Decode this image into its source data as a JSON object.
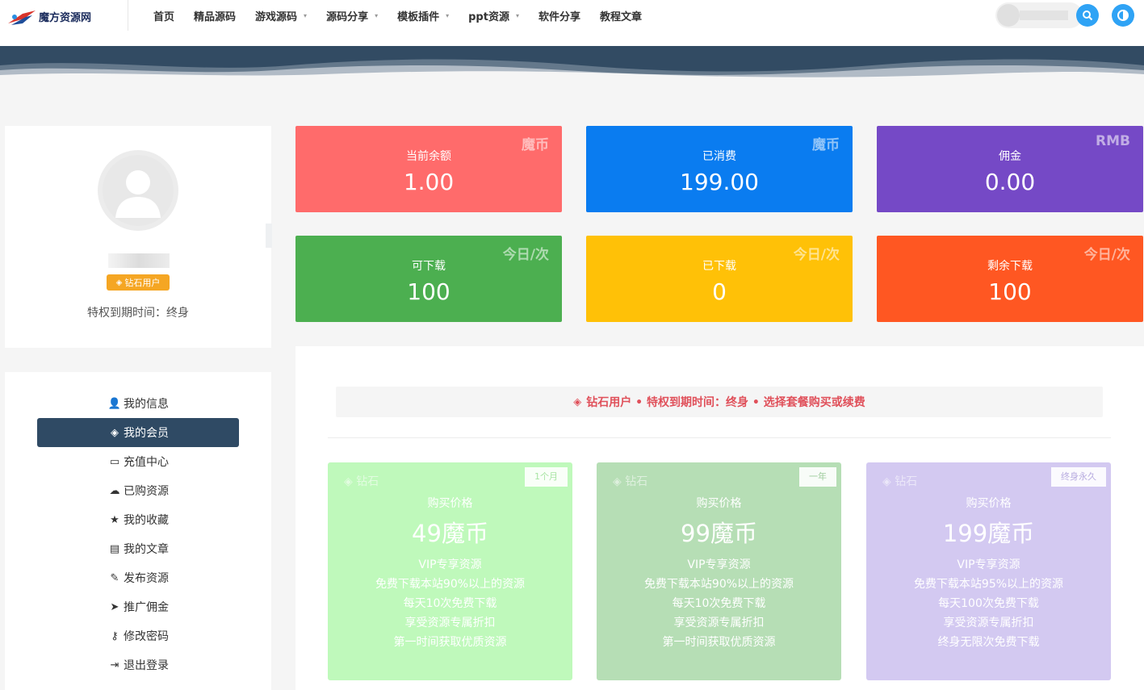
{
  "header": {
    "logo_text": "魔方资源网",
    "nav": [
      {
        "label": "首页",
        "dropdown": false
      },
      {
        "label": "精品源码",
        "dropdown": false
      },
      {
        "label": "游戏源码",
        "dropdown": true
      },
      {
        "label": "源码分享",
        "dropdown": true
      },
      {
        "label": "模板插件",
        "dropdown": true
      },
      {
        "label": "ppt资源",
        "dropdown": true
      },
      {
        "label": "软件分享",
        "dropdown": false
      },
      {
        "label": "教程文章",
        "dropdown": false
      }
    ],
    "icons": {
      "search": "search-icon",
      "theme": "theme-toggle-icon",
      "dropdown": "chevron-down-icon"
    }
  },
  "profile": {
    "badge": "钻石用户",
    "expire": "特权到期时间：终身"
  },
  "menu": [
    {
      "label": "我的信息",
      "icon": "user-icon",
      "glyph": "👤",
      "active": false
    },
    {
      "label": "我的会员",
      "icon": "diamond-icon",
      "glyph": "◈",
      "active": true
    },
    {
      "label": "充值中心",
      "icon": "credit-card-icon",
      "glyph": "▭",
      "active": false
    },
    {
      "label": "已购资源",
      "icon": "cloud-download-icon",
      "glyph": "☁",
      "active": false
    },
    {
      "label": "我的收藏",
      "icon": "star-icon",
      "glyph": "★",
      "active": false
    },
    {
      "label": "我的文章",
      "icon": "document-icon",
      "glyph": "▤",
      "active": false
    },
    {
      "label": "发布资源",
      "icon": "pencil-icon",
      "glyph": "✎",
      "active": false
    },
    {
      "label": "推广佣金",
      "icon": "paper-plane-icon",
      "glyph": "➤",
      "active": false
    },
    {
      "label": "修改密码",
      "icon": "key-icon",
      "glyph": "⚷",
      "active": false
    },
    {
      "label": "退出登录",
      "icon": "sign-out-icon",
      "glyph": "⇥",
      "active": false
    }
  ],
  "stats": [
    {
      "label": "当前余额",
      "value": "1.00",
      "unit": "魔币",
      "color": "#ff6b6b"
    },
    {
      "label": "已消费",
      "value": "199.00",
      "unit": "魔币",
      "color": "#0a7cf0"
    },
    {
      "label": "佣金",
      "value": "0.00",
      "unit": "RMB",
      "color": "#7549c6"
    },
    {
      "label": "可下载",
      "value": "100",
      "unit": "今日/次",
      "color": "#4caf50"
    },
    {
      "label": "已下载",
      "value": "0",
      "unit": "今日/次",
      "color": "#ffc107"
    },
    {
      "label": "剩余下载",
      "value": "100",
      "unit": "今日/次",
      "color": "#ff5722"
    }
  ],
  "notice": "钻石用户 • 特权到期时间：终身 • 选择套餐购买或续费",
  "plans": [
    {
      "tier": "钻石",
      "ribbon": "1个月",
      "caption": "购买价格",
      "price": "49魔币",
      "color": "#bff9bb",
      "features": [
        "VIP专享资源",
        "免费下载本站90%以上的资源",
        "每天10次免费下载",
        "享受资源专属折扣",
        "第一时间获取优质资源"
      ]
    },
    {
      "tier": "钻石",
      "ribbon": "一年",
      "caption": "购买价格",
      "price": "99魔币",
      "color": "#b6deb5",
      "features": [
        "VIP专享资源",
        "免费下载本站90%以上的资源",
        "每天10次免费下载",
        "享受资源专属折扣",
        "第一时间获取优质资源"
      ]
    },
    {
      "tier": "钻石",
      "ribbon": "终身永久",
      "caption": "购买价格",
      "price": "199魔币",
      "color": "#d3c9f1",
      "features": [
        "VIP专享资源",
        "免费下载本站95%以上的资源",
        "每天100次免费下载",
        "享受资源专属折扣",
        "终身无限次免费下载"
      ]
    }
  ]
}
